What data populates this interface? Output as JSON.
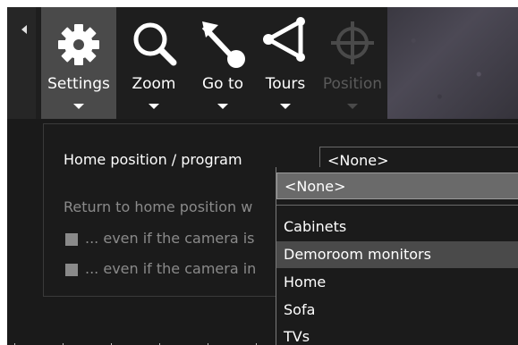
{
  "toolbar": {
    "tools": [
      {
        "id": "settings",
        "label": "Settings",
        "icon": "gear-icon"
      },
      {
        "id": "zoom",
        "label": "Zoom",
        "icon": "magnifier-icon"
      },
      {
        "id": "goto",
        "label": "Go to",
        "icon": "goto-arrow-icon"
      },
      {
        "id": "tours",
        "label": "Tours",
        "icon": "tours-icon"
      },
      {
        "id": "position",
        "label": "Position",
        "icon": "crosshair-icon"
      }
    ]
  },
  "panel": {
    "home_label": "Home position / program",
    "return_label": "Return to home position w",
    "checkbox1_label": "... even if the camera is",
    "checkbox2_label": "... even if the camera in"
  },
  "select": {
    "value": "<None>",
    "options": [
      "<None>",
      "Cabinets",
      "Demoroom monitors",
      "Home",
      "Sofa",
      "TVs"
    ]
  },
  "colors": {
    "background": "#1a1a1a",
    "active_tool": "#4a4a4a",
    "selected_option": "#6a6a6a",
    "hover_option": "#4a4a4a"
  }
}
